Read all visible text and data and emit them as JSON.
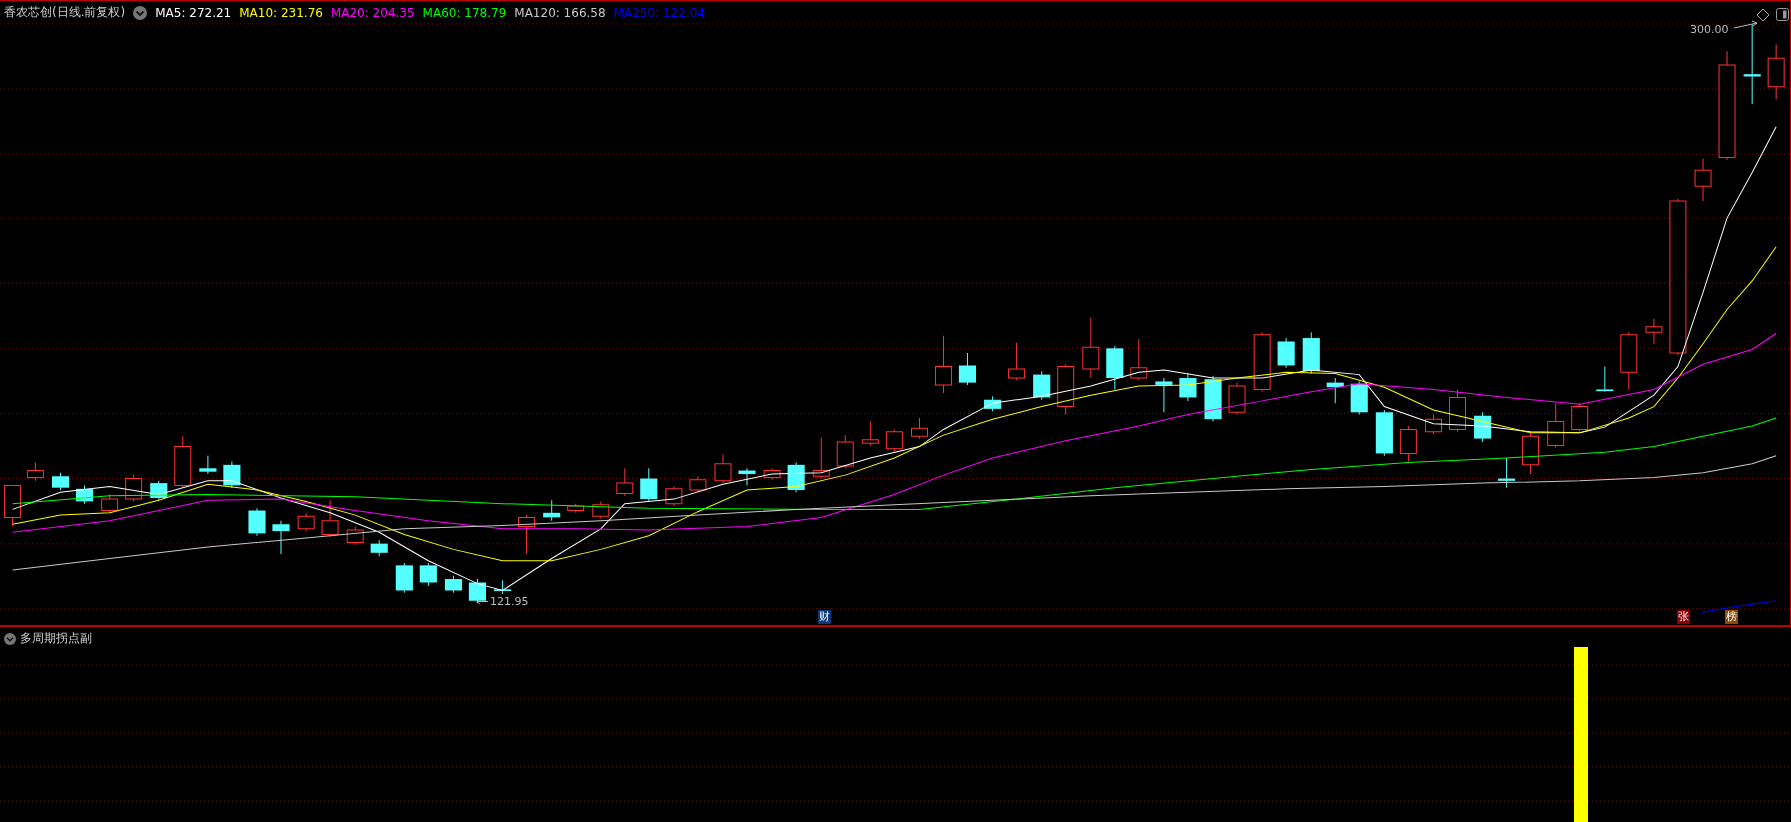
{
  "header": {
    "title": "香农芯创(日线.前复权)",
    "indicators": [
      {
        "label": "MA5: 272.21",
        "color": "#ffffff"
      },
      {
        "label": "MA10: 231.76",
        "color": "#ffff00"
      },
      {
        "label": "MA20: 204.35",
        "color": "#ff00ff"
      },
      {
        "label": "MA60: 178.79",
        "color": "#00ff00"
      },
      {
        "label": "MA120: 166.58",
        "color": "#c8c8c8"
      },
      {
        "label": "MA250: 122.04",
        "color": "#0000ff"
      }
    ]
  },
  "main_chart": {
    "high_label": "300.00",
    "low_label": "121.95",
    "markers": [
      {
        "text": "财",
        "color": "#0a3a78"
      },
      {
        "text": "张",
        "color": "#8a0000"
      },
      {
        "text": "榜",
        "color": "#8a4a00"
      }
    ]
  },
  "sub_panel": {
    "title": "多周期拐点副"
  }
}
